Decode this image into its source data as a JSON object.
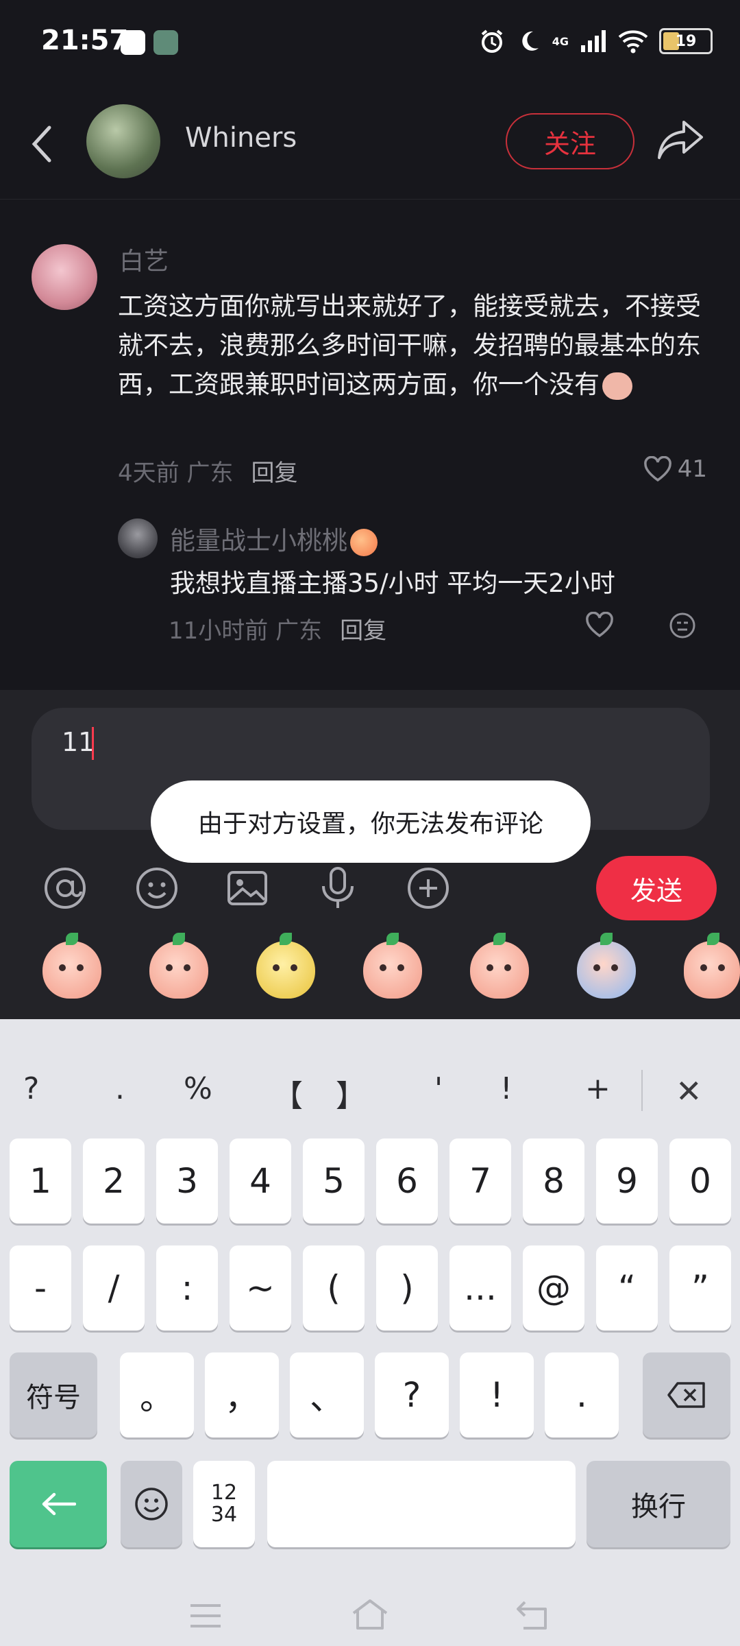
{
  "status_bar": {
    "time": "21:57",
    "network": "4G",
    "battery": "19"
  },
  "header": {
    "username": "Whiners",
    "follow_label": "关注"
  },
  "comment": {
    "author": "白艺",
    "text": "工资这方面你就写出来就好了，能接受就去，不接受就不去，浪费那么多时间干嘛，发招聘的最基本的东西，工资跟兼职时间这两方面，你一个没有",
    "time_location": "4天前 广东",
    "reply_label": "回复",
    "likes": "41"
  },
  "reply": {
    "author": "能量战士小桃桃",
    "text": "我想找直播主播35/小时 平均一天2小时",
    "time_location": "11小时前 广东",
    "reply_label": "回复"
  },
  "composer": {
    "input_value": "11",
    "toast": "由于对方设置，你无法发布评论",
    "send_label": "发送",
    "tools": [
      "at-icon",
      "emoji-icon",
      "image-icon",
      "microphone-icon",
      "plus-icon"
    ],
    "stickers": [
      "covering-mouth",
      "laughing-crying",
      "yellow-pup",
      "pleading",
      "heart-kiss",
      "crying-waterfall",
      "smiling"
    ]
  },
  "keyboard": {
    "symbol_row": [
      "?",
      ".",
      "%",
      "【",
      "】",
      "'",
      "!",
      "+"
    ],
    "row1": [
      "1",
      "2",
      "3",
      "4",
      "5",
      "6",
      "7",
      "8",
      "9",
      "0"
    ],
    "row2": [
      "-",
      "/",
      ":",
      "~",
      "(",
      ")",
      "...",
      "@",
      "“",
      "”"
    ],
    "row3_left": "符号",
    "row3": [
      "。",
      "，",
      "、",
      "?",
      "!",
      "."
    ],
    "numpad_label_top": "12",
    "numpad_label_bottom": "34",
    "return_label": "换行"
  },
  "colors": {
    "accent_red": "#ef2f45",
    "enter_green": "#4fc48c",
    "background": "#17171c"
  }
}
